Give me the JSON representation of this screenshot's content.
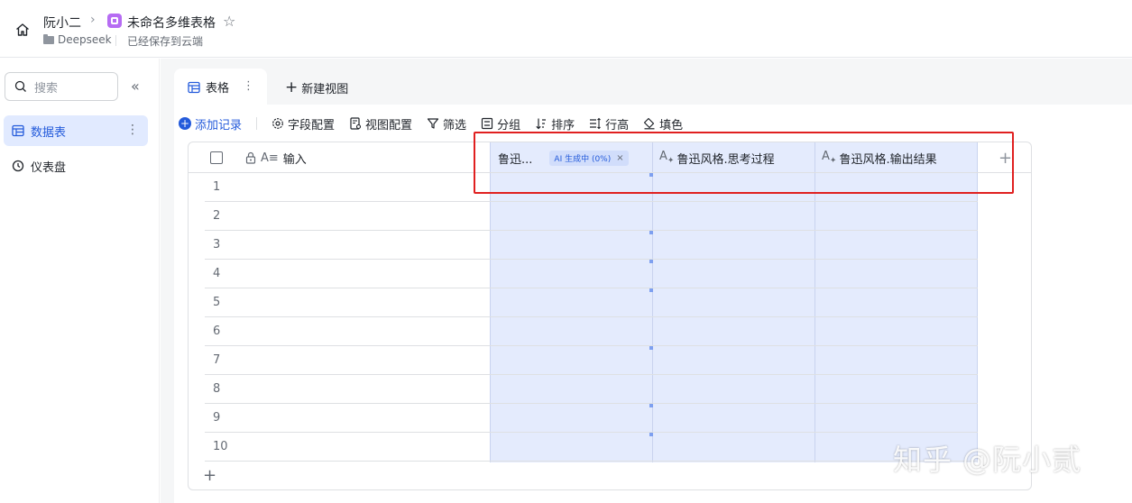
{
  "header": {
    "user_name": "阮小二",
    "doc_title": "未命名多维表格",
    "folder_name": "Deepseek",
    "save_status": "已经保存到云端"
  },
  "sidebar": {
    "search_placeholder": "搜索",
    "items": [
      {
        "label": "数据表",
        "icon": "table-icon",
        "active": true
      },
      {
        "label": "仪表盘",
        "icon": "dashboard-icon",
        "active": false
      }
    ]
  },
  "tabs": {
    "active_label": "表格",
    "new_view_label": "新建视图"
  },
  "toolbar": {
    "add_record": "添加记录",
    "field_config": "字段配置",
    "view_config": "视图配置",
    "filter": "筛选",
    "group": "分组",
    "sort": "排序",
    "row_height": "行高",
    "fill_color": "填色"
  },
  "grid": {
    "columns": [
      {
        "label": "输入",
        "icon": "text-field-icon",
        "locked": true
      },
      {
        "label": "鲁迅...",
        "icon": "",
        "chip": "AI 生成中 (0%)"
      },
      {
        "label": "鲁迅风格.思考过程",
        "icon": "ai-text-field-icon"
      },
      {
        "label": "鲁迅风格.输出结果",
        "icon": "ai-text-field-icon"
      }
    ],
    "row_numbers": [
      "1",
      "2",
      "3",
      "4",
      "5",
      "6",
      "7",
      "8",
      "9",
      "10"
    ]
  },
  "watermark": "知乎 @阮小贰",
  "colors": {
    "accent": "#245bdb",
    "ai_column_bg": "#e4ebfd",
    "highlight": "#e02020",
    "app_badge": "#b66cf3"
  }
}
